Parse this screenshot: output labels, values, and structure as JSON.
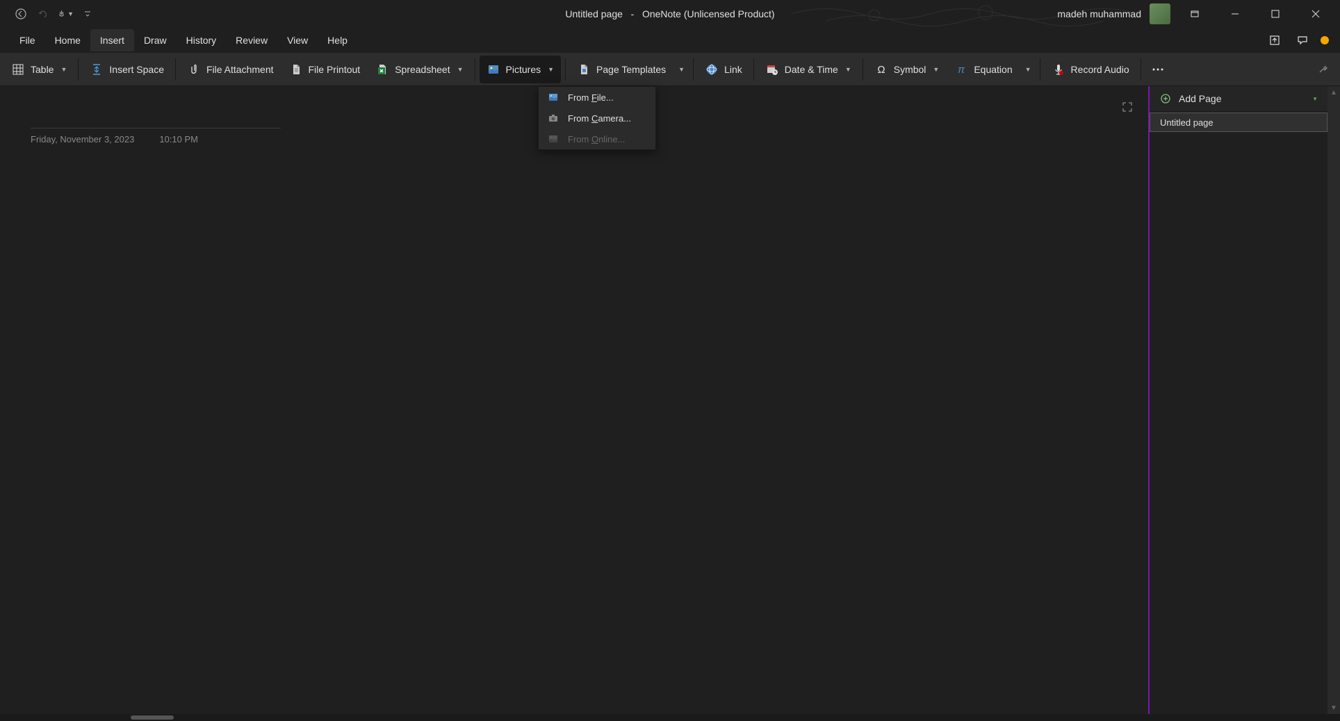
{
  "title_bar": {
    "document_title": "Untitled page",
    "separator": "-",
    "app_title": "OneNote (Unlicensed Product)",
    "user_name": "madeh muhammad"
  },
  "menu": {
    "items": [
      "File",
      "Home",
      "Insert",
      "Draw",
      "History",
      "Review",
      "View",
      "Help"
    ],
    "active_index": 2
  },
  "ribbon": {
    "table": "Table",
    "insert_space": "Insert Space",
    "file_attachment": "File Attachment",
    "file_printout": "File Printout",
    "spreadsheet": "Spreadsheet",
    "pictures": "Pictures",
    "page_templates": "Page Templates",
    "link": "Link",
    "date_time": "Date & Time",
    "symbol": "Symbol",
    "equation": "Equation",
    "record_audio": "Record Audio"
  },
  "pictures_dropdown": {
    "from_file_prefix": "From ",
    "from_file_u": "F",
    "from_file_suffix": "ile...",
    "from_camera_prefix": "From ",
    "from_camera_u": "C",
    "from_camera_suffix": "amera...",
    "from_online_prefix": "From ",
    "from_online_u": "O",
    "from_online_suffix": "nline..."
  },
  "page": {
    "date": "Friday, November 3, 2023",
    "time": "10:10 PM"
  },
  "side_panel": {
    "add_page": "Add Page",
    "pages": [
      "Untitled page"
    ]
  }
}
